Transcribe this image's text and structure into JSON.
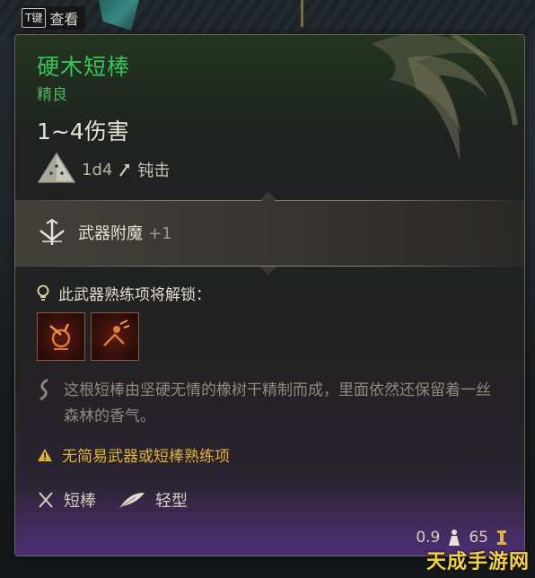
{
  "hint": {
    "key": "T键",
    "action": "查看"
  },
  "item": {
    "name": "硬木短棒",
    "rarity": "精良",
    "damage": "1~4伤害",
    "dice": "1d4",
    "damage_type": "钝击",
    "enchantment_label": "武器附魔",
    "enchantment_value": "+1",
    "unlock_label": "此武器熟练项将解锁：",
    "skills": [
      "skill-icon-1",
      "skill-icon-2"
    ],
    "description": "这根短棒由坚硬无情的橡树干精制而成，里面依然还保留着一丝森林的香气。",
    "warning": "无简易武器或短棒熟练项",
    "properties": [
      "短棒",
      "轻型"
    ],
    "weight": "0.9",
    "value": "65"
  },
  "watermark": "天成手游网",
  "colors": {
    "name": "#3bc25a",
    "warning": "#e0b23a",
    "border": "#6e6450"
  }
}
